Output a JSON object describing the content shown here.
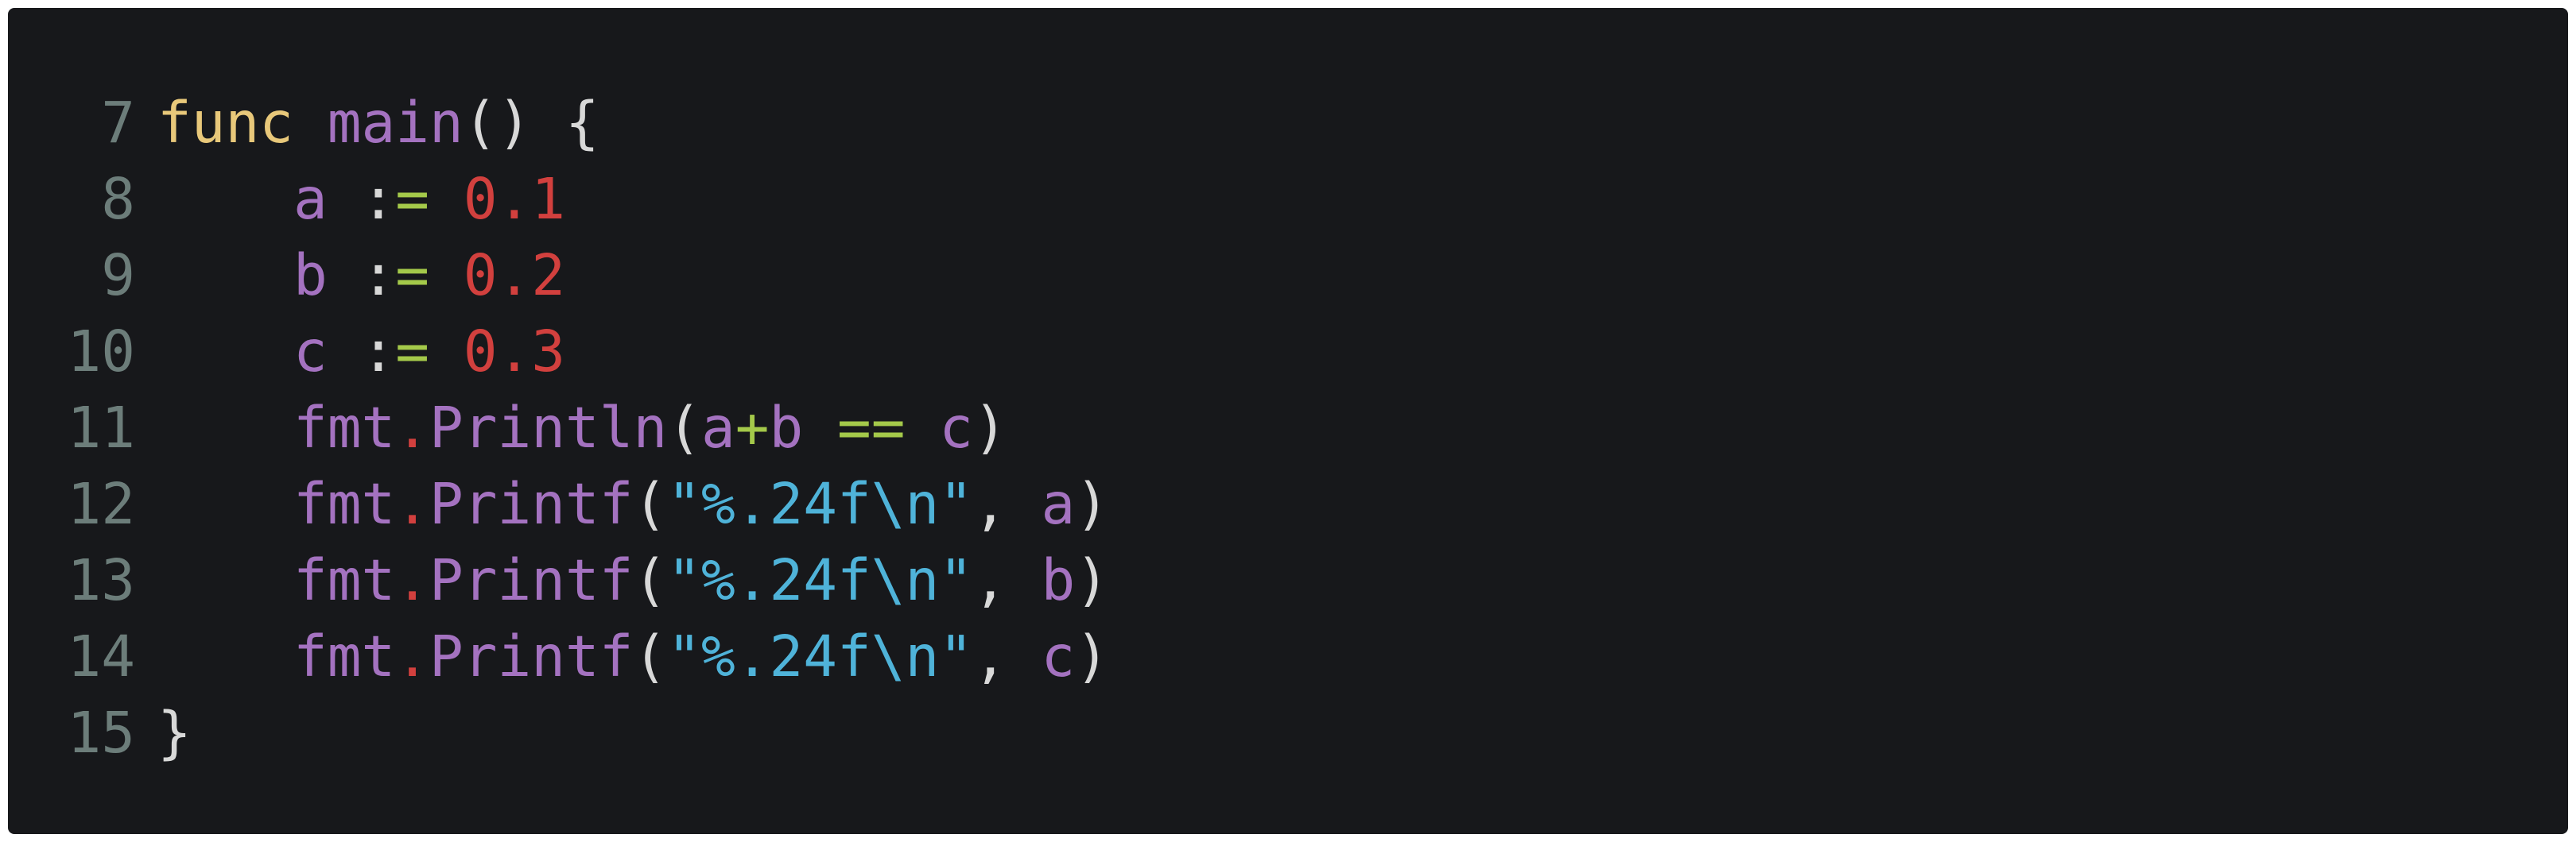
{
  "code_view": {
    "language": "go",
    "lines": [
      {
        "number": "7",
        "tokens": [
          {
            "text": "func",
            "kind": "kw"
          },
          {
            "text": " ",
            "kind": "pun"
          },
          {
            "text": "main",
            "kind": "fn"
          },
          {
            "text": "() {",
            "kind": "pun"
          }
        ]
      },
      {
        "number": "8",
        "tokens": [
          {
            "text": "    ",
            "kind": "pun"
          },
          {
            "text": "a",
            "kind": "id"
          },
          {
            "text": " :",
            "kind": "pun"
          },
          {
            "text": "=",
            "kind": "op"
          },
          {
            "text": " ",
            "kind": "pun"
          },
          {
            "text": "0.1",
            "kind": "num"
          }
        ]
      },
      {
        "number": "9",
        "tokens": [
          {
            "text": "    ",
            "kind": "pun"
          },
          {
            "text": "b",
            "kind": "id"
          },
          {
            "text": " :",
            "kind": "pun"
          },
          {
            "text": "=",
            "kind": "op"
          },
          {
            "text": " ",
            "kind": "pun"
          },
          {
            "text": "0.2",
            "kind": "num"
          }
        ]
      },
      {
        "number": "10",
        "tokens": [
          {
            "text": "    ",
            "kind": "pun"
          },
          {
            "text": "c",
            "kind": "id"
          },
          {
            "text": " :",
            "kind": "pun"
          },
          {
            "text": "=",
            "kind": "op"
          },
          {
            "text": " ",
            "kind": "pun"
          },
          {
            "text": "0.3",
            "kind": "num"
          }
        ]
      },
      {
        "number": "11",
        "tokens": [
          {
            "text": "    ",
            "kind": "pun"
          },
          {
            "text": "fmt",
            "kind": "id"
          },
          {
            "text": ".",
            "kind": "dot"
          },
          {
            "text": "Println",
            "kind": "fn"
          },
          {
            "text": "(",
            "kind": "pun"
          },
          {
            "text": "a",
            "kind": "id"
          },
          {
            "text": "+",
            "kind": "op"
          },
          {
            "text": "b",
            "kind": "id"
          },
          {
            "text": " ",
            "kind": "pun"
          },
          {
            "text": "==",
            "kind": "op"
          },
          {
            "text": " ",
            "kind": "pun"
          },
          {
            "text": "c",
            "kind": "id"
          },
          {
            "text": ")",
            "kind": "pun"
          }
        ]
      },
      {
        "number": "12",
        "tokens": [
          {
            "text": "    ",
            "kind": "pun"
          },
          {
            "text": "fmt",
            "kind": "id"
          },
          {
            "text": ".",
            "kind": "dot"
          },
          {
            "text": "Printf",
            "kind": "fn"
          },
          {
            "text": "(",
            "kind": "pun"
          },
          {
            "text": "\"%.24f\\n\"",
            "kind": "str"
          },
          {
            "text": ", ",
            "kind": "pun"
          },
          {
            "text": "a",
            "kind": "id"
          },
          {
            "text": ")",
            "kind": "pun"
          }
        ]
      },
      {
        "number": "13",
        "tokens": [
          {
            "text": "    ",
            "kind": "pun"
          },
          {
            "text": "fmt",
            "kind": "id"
          },
          {
            "text": ".",
            "kind": "dot"
          },
          {
            "text": "Printf",
            "kind": "fn"
          },
          {
            "text": "(",
            "kind": "pun"
          },
          {
            "text": "\"%.24f\\n\"",
            "kind": "str"
          },
          {
            "text": ", ",
            "kind": "pun"
          },
          {
            "text": "b",
            "kind": "id"
          },
          {
            "text": ")",
            "kind": "pun"
          }
        ]
      },
      {
        "number": "14",
        "tokens": [
          {
            "text": "    ",
            "kind": "pun"
          },
          {
            "text": "fmt",
            "kind": "id"
          },
          {
            "text": ".",
            "kind": "dot"
          },
          {
            "text": "Printf",
            "kind": "fn"
          },
          {
            "text": "(",
            "kind": "pun"
          },
          {
            "text": "\"%.24f\\n\"",
            "kind": "str"
          },
          {
            "text": ", ",
            "kind": "pun"
          },
          {
            "text": "c",
            "kind": "id"
          },
          {
            "text": ")",
            "kind": "pun"
          }
        ]
      },
      {
        "number": "15",
        "tokens": [
          {
            "text": "}",
            "kind": "pun"
          }
        ]
      }
    ]
  },
  "colors": {
    "background": "#17181b",
    "line_number": "#6c7d7a",
    "keyword": "#e8c87a",
    "identifier": "#a472c0",
    "number": "#d2403e",
    "operator": "#a4c94a",
    "string": "#4fb3d9",
    "punctuation": "#d8d8d8"
  }
}
